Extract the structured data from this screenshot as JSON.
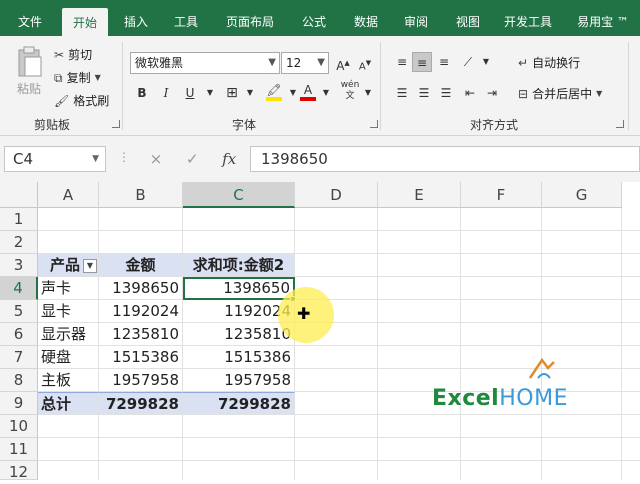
{
  "tabs": [
    "文件",
    "开始",
    "插入",
    "工具",
    "页面布局",
    "公式",
    "数据",
    "审阅",
    "视图",
    "开发工具",
    "易用宝 ™"
  ],
  "active_tab": "开始",
  "clipboard": {
    "paste": "粘贴",
    "cut": "剪切",
    "copy": "复制",
    "format_painter": "格式刷",
    "label": "剪贴板"
  },
  "font": {
    "name": "微软雅黑",
    "size": "12",
    "grow": "A",
    "shrink": "A",
    "bold": "B",
    "italic": "I",
    "underline": "U",
    "label": "字体"
  },
  "alignment": {
    "wrap_text": "自动换行",
    "merge_center": "合并后居中",
    "label": "对齐方式"
  },
  "formula_bar": {
    "name_box": "C4",
    "cancel": "×",
    "confirm": "✓",
    "fx": "fx",
    "value": "1398650"
  },
  "columns": [
    "A",
    "B",
    "C",
    "D",
    "E",
    "F",
    "G"
  ],
  "rows": [
    "1",
    "2",
    "3",
    "4",
    "5",
    "6",
    "7",
    "8",
    "9",
    "10",
    "11",
    "12"
  ],
  "pivot": {
    "headers": [
      "产品",
      "金额",
      "求和项:金额2"
    ],
    "rows": [
      [
        "声卡",
        "1398650",
        "1398650"
      ],
      [
        "显卡",
        "1192024",
        "1192024"
      ],
      [
        "显示器",
        "1235810",
        "1235810"
      ],
      [
        "硬盘",
        "1515386",
        "1515386"
      ],
      [
        "主板",
        "1957958",
        "1957958"
      ]
    ],
    "total": [
      "总计",
      "7299828",
      "7299828"
    ]
  },
  "logo": {
    "excel": "Excel",
    "home": "HOME"
  },
  "colors": {
    "excel_green": "#217346",
    "pivot_header": "#d9e1f2",
    "logo_green": "#1f8a3d",
    "logo_blue": "#3a9ad9"
  }
}
